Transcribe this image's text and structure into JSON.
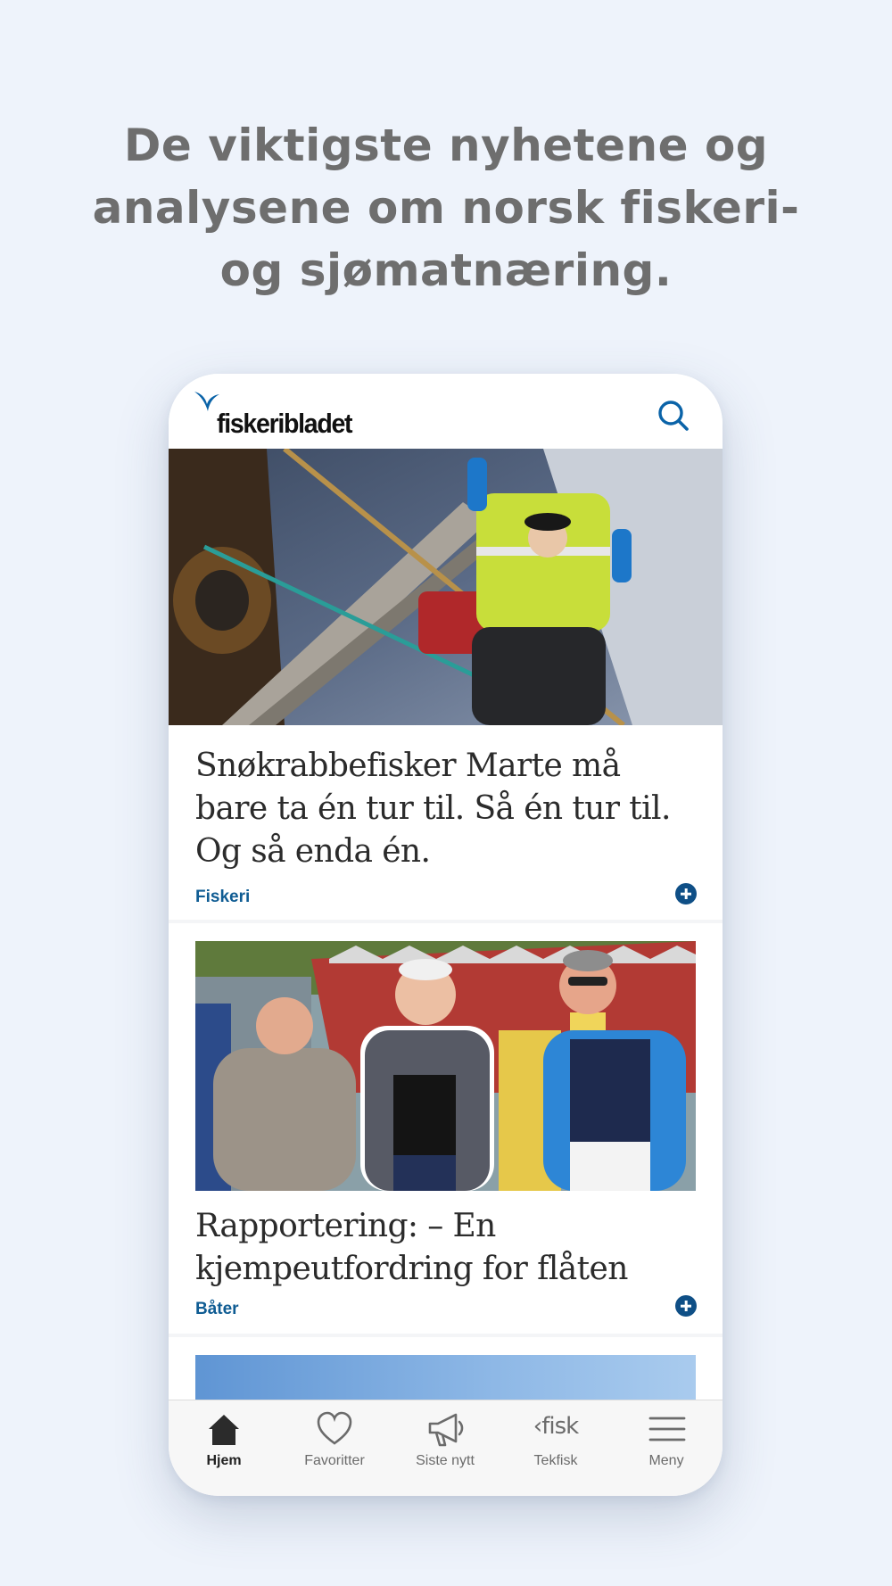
{
  "promo": {
    "headline_line1": "De viktigste nyhetene og",
    "headline_line2": "analysene om norsk fiskeri-",
    "headline_line3": "og sjømatnæring."
  },
  "app": {
    "brand": "fiskeribladet",
    "search_icon": "search-icon",
    "accent_color": "#0f5c93"
  },
  "articles": [
    {
      "title_line1": "Snøkrabbefisker Marte må",
      "title_line2": "bare ta én tur til. Så én tur til.",
      "title_line3": "Og så enda én.",
      "category": "Fiskeri"
    },
    {
      "title_line1": "Rapportering: – En",
      "title_line2": "kjempeutfordring for flåten",
      "category": "Båter"
    }
  ],
  "tabbar": {
    "tabs": [
      {
        "label": "Hjem",
        "icon": "home-icon",
        "active": true
      },
      {
        "label": "Favoritter",
        "icon": "heart-icon",
        "active": false
      },
      {
        "label": "Siste nytt",
        "icon": "megaphone-icon",
        "active": false
      },
      {
        "label": "Tekfisk",
        "icon": "fisk-logo",
        "logo_text": "‹fisk",
        "active": false
      },
      {
        "label": "Meny",
        "icon": "menu-icon",
        "active": false
      }
    ]
  }
}
